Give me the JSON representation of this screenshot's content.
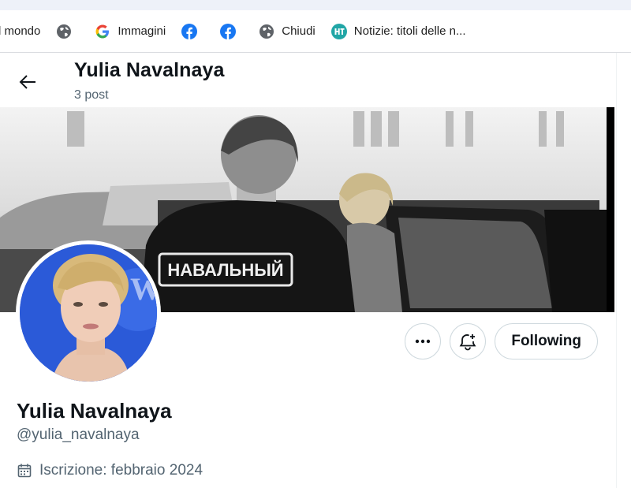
{
  "bookmarks": [
    {
      "label": "l mondo",
      "icon": "none"
    },
    {
      "label": "",
      "icon": "globe-icon"
    },
    {
      "label": "Immagini",
      "icon": "google-icon"
    },
    {
      "label": "",
      "icon": "facebook-icon"
    },
    {
      "label": "",
      "icon": "facebook-icon"
    },
    {
      "label": "Chiudi",
      "icon": "globe-icon"
    },
    {
      "label": "Notizie: titoli delle n...",
      "icon": "ht-icon"
    }
  ],
  "header": {
    "name": "Yulia Navalnaya",
    "posts": "3 post"
  },
  "banner": {
    "jacket_text": "НАВАЛЬНЫЙ"
  },
  "actions": {
    "following_label": "Following"
  },
  "profile": {
    "name": "Yulia Navalnaya",
    "handle": "@yulia_navalnaya",
    "joined": "Iscrizione: febbraio 2024"
  },
  "colors": {
    "facebook": "#1877f2",
    "ht": "#21a6a6",
    "muted_text": "#536471"
  }
}
